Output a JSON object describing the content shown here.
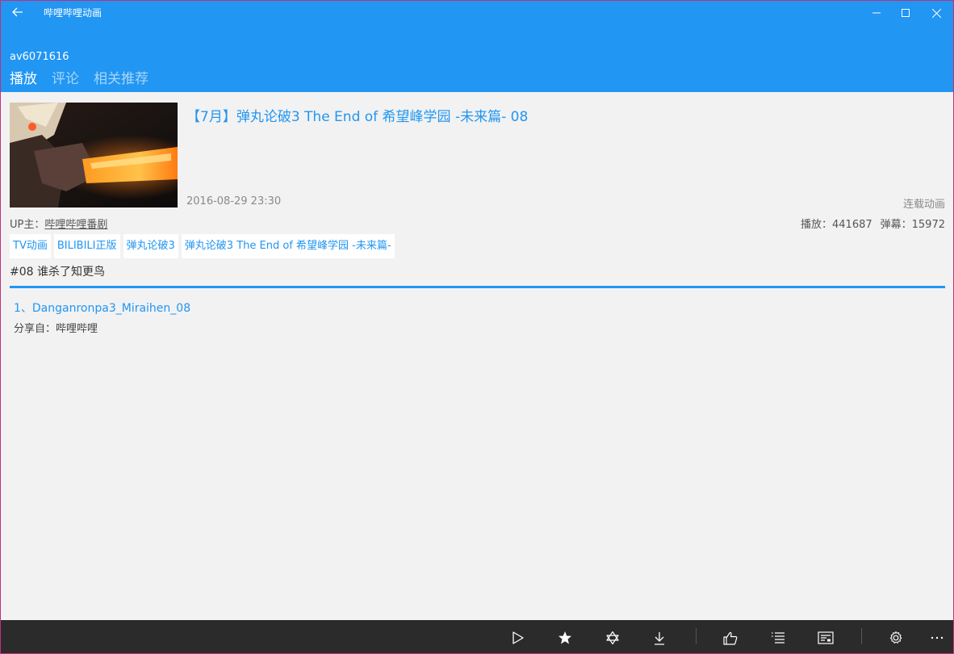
{
  "app": {
    "title": "哔哩哔哩动画",
    "av_id": "av6071616"
  },
  "tabs": [
    {
      "label": "播放",
      "active": true
    },
    {
      "label": "评论",
      "active": false
    },
    {
      "label": "相关推荐",
      "active": false
    }
  ],
  "video": {
    "title": "【7月】弹丸论破3 The End of 希望峰学园 -未来篇- 08",
    "date": "2016-08-29 23:30",
    "category": "连载动画",
    "up_label": "UP主：",
    "up_name": "哔哩哔哩番剧",
    "plays": "播放：441687",
    "danmaku": "弹幕：15972",
    "tags": [
      "TV动画",
      "BILIBILI正版",
      "弹丸论破3",
      "弹丸论破3 The End of 希望峰学园 -未来篇-"
    ],
    "episode_desc": "#08 谁杀了知更鸟",
    "parts": [
      "1、Danganronpa3_Miraihen_08"
    ],
    "share_from": "分享自：哔哩哔哩"
  },
  "colors": {
    "accent": "#2196f3",
    "appbar": "#2b2b2b",
    "background": "#f2f2f2"
  },
  "appbar_icons": [
    "play-icon",
    "favorite-star-icon",
    "coin-icon",
    "download-icon",
    "like-icon",
    "playlist-icon",
    "danmaku-icon",
    "settings-icon",
    "more-icon"
  ]
}
